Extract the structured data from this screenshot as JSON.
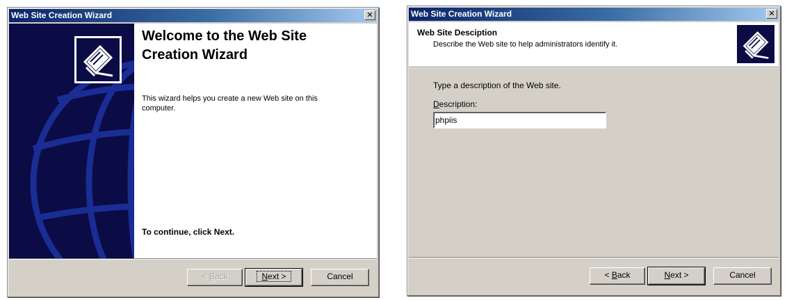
{
  "wizard1": {
    "title": "Web Site Creation Wizard",
    "close_glyph": "✕",
    "heading": "Welcome to the Web Site Creation Wizard",
    "body": "This wizard helps you create a new Web site on this computer.",
    "continue_text": "To continue, click Next.",
    "buttons": {
      "back_mnemonic": "B",
      "back_rest": "ack",
      "back_prefix": "< ",
      "next_mnemonic": "N",
      "next_rest": "ext >",
      "cancel": "Cancel"
    },
    "back_enabled": false
  },
  "wizard2": {
    "title": "Web Site Creation Wizard",
    "close_glyph": "✕",
    "header_title": "Web Site Desciption",
    "header_subtitle": "Describe the Web site to help administrators identify it.",
    "instruction": "Type a description of the Web site.",
    "label_mnemonic": "D",
    "label_rest": "escription:",
    "description_value": "phpiis",
    "buttons": {
      "back_mnemonic": "B",
      "back_rest": "ack",
      "back_prefix": "< ",
      "next_mnemonic": "N",
      "next_rest": "ext >",
      "cancel": "Cancel"
    }
  },
  "colors": {
    "titlebar_start": "#0a246a",
    "titlebar_end": "#a6caf0",
    "dialog_face": "#d4d0c8",
    "banner": "#0b0b45"
  },
  "icons": {
    "wizard_banner_icon": "book-with-pen-icon",
    "globe_graphic": "globe-icon"
  }
}
